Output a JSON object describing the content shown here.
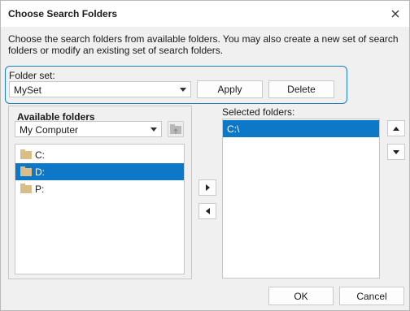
{
  "window": {
    "title": "Choose Search Folders"
  },
  "description": "Choose the search folders from available folders. You may also create a new set of search folders or modify an existing set of search folders.",
  "folder_set": {
    "label": "Folder set:",
    "value": "MySet",
    "apply_label": "Apply",
    "delete_label": "Delete"
  },
  "available": {
    "title": "Available folders",
    "source_value": "My Computer",
    "items": [
      {
        "label": "C:",
        "selected": false
      },
      {
        "label": "D:",
        "selected": true
      },
      {
        "label": "P:",
        "selected": false
      }
    ]
  },
  "selected": {
    "label": "Selected folders:",
    "items": [
      {
        "label": "C:\\",
        "selected": true
      }
    ]
  },
  "footer": {
    "ok_label": "OK",
    "cancel_label": "Cancel"
  },
  "colors": {
    "accent": "#0c78c7",
    "focus_border": "#1c7cbd",
    "folder": "#d9bf87"
  }
}
